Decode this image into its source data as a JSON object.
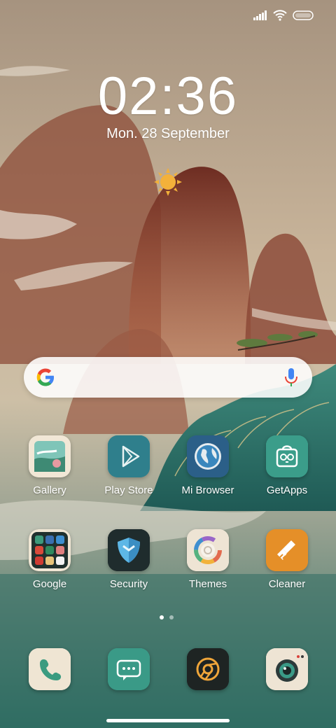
{
  "lockscreen": {
    "time": "02:36",
    "date": "Mon. 28 September"
  },
  "weather": {
    "icon": "sun-icon"
  },
  "search": {
    "provider": "Google",
    "mic_icon": "mic-icon"
  },
  "apps": [
    {
      "label": "Gallery",
      "icon": "gallery-icon"
    },
    {
      "label": "Play Store",
      "icon": "play-store-icon"
    },
    {
      "label": "Mi Browser",
      "icon": "globe-icon"
    },
    {
      "label": "GetApps",
      "icon": "getapps-icon"
    },
    {
      "label": "Google",
      "icon": "google-folder-icon"
    },
    {
      "label": "Security",
      "icon": "shield-icon"
    },
    {
      "label": "Themes",
      "icon": "themes-icon"
    },
    {
      "label": "Cleaner",
      "icon": "broom-icon"
    }
  ],
  "dock": [
    {
      "icon": "phone-icon"
    },
    {
      "icon": "messages-icon"
    },
    {
      "icon": "chrome-icon"
    },
    {
      "icon": "camera-icon"
    }
  ],
  "pager": {
    "pages": 2,
    "current": 1
  },
  "colors": {
    "sky": "#b9a58c",
    "mountain": "#7a3a2c",
    "water": "#3a7a6e",
    "accent_orange": "#e8922a",
    "accent_teal": "#3fa58f"
  }
}
